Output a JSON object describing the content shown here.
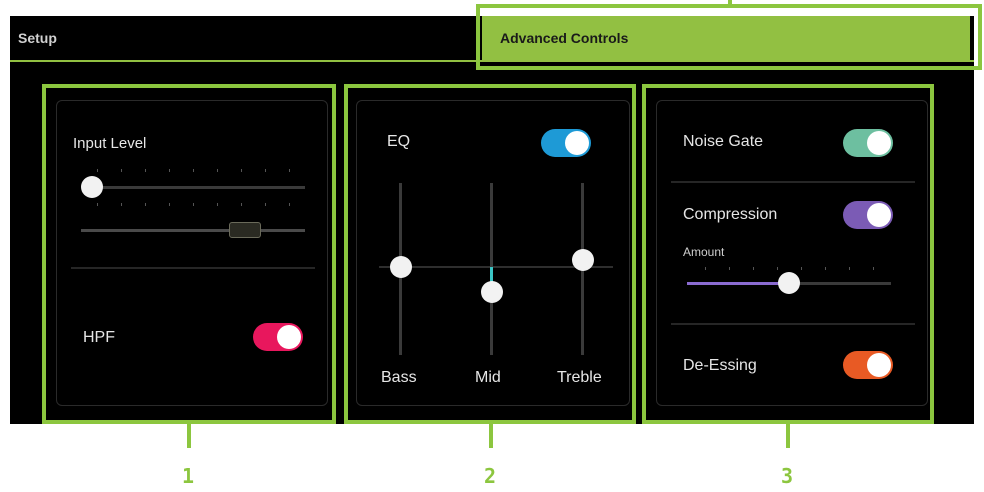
{
  "tabs": {
    "setup": "Setup",
    "advanced": "Advanced Controls"
  },
  "panel1": {
    "input_level_label": "Input Level",
    "input_level_value": 0.0,
    "hpf_label": "HPF",
    "hpf_on": true
  },
  "panel2": {
    "eq_label": "EQ",
    "eq_on": true,
    "bands": [
      {
        "label": "Bass",
        "value": 0.0
      },
      {
        "label": "Mid",
        "value": -0.15
      },
      {
        "label": "Treble",
        "value": 0.05
      }
    ]
  },
  "panel3": {
    "noise_gate_label": "Noise Gate",
    "noise_gate_on": true,
    "compression_label": "Compression",
    "compression_on": true,
    "amount_label": "Amount",
    "amount_value": 0.5,
    "deessing_label": "De-Essing",
    "deessing_on": true
  },
  "callouts": [
    "1",
    "2",
    "3"
  ],
  "colors": {
    "callout": "#8cc63f",
    "hpf": "#e8175d",
    "eq": "#1e9ad6",
    "noise_gate": "#6dbfa0",
    "compression": "#7b5bb5",
    "compression_fill": "#8a6bd0",
    "deessing": "#e85a24",
    "mid_highlight": "#3bc6c6"
  }
}
